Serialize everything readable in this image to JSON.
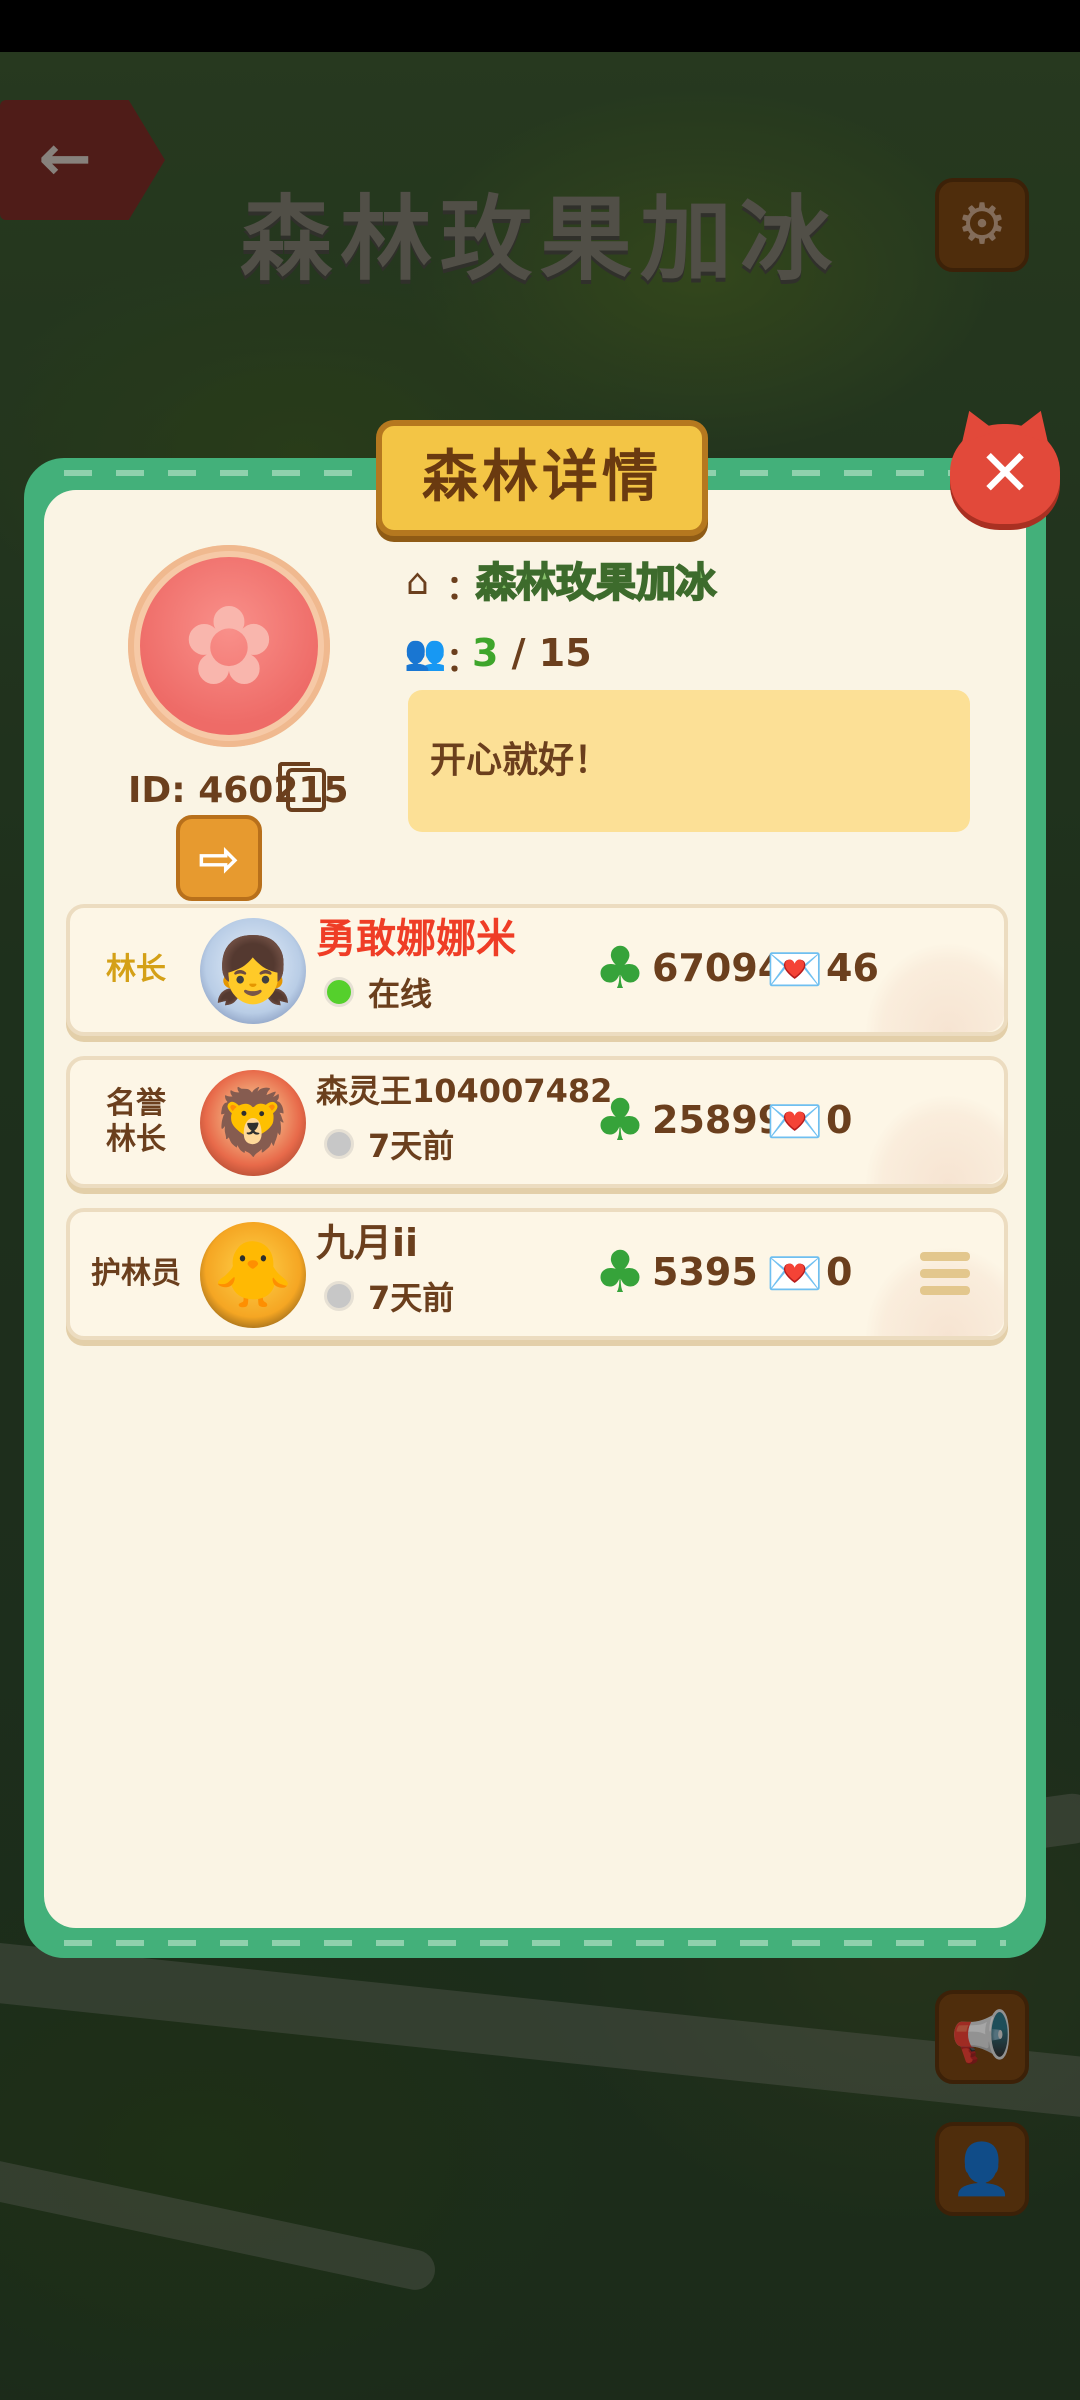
{
  "background": {
    "title": "森林玫果加冰",
    "back_icon": "arrow-left-icon",
    "settings_icon": "gear-icon",
    "side_buttons": [
      "megaphone-icon",
      "profile-card-icon"
    ]
  },
  "dialog": {
    "title": "森林详情",
    "close_label": "✕",
    "forest": {
      "id_text": "ID: 460215",
      "name_label": "：",
      "name": "森林玫果加冰",
      "members_label": "：",
      "members_current": "3",
      "members_sep": " / ",
      "members_max": "15",
      "motto": "开心就好！"
    },
    "members": [
      {
        "role": "林长",
        "name": "勇敢娜娜米",
        "status": "在线",
        "online": true,
        "clovers": "67094",
        "hearts": "46"
      },
      {
        "role": "名誉林长",
        "name": "森灵王104007482",
        "status": "7天前",
        "online": false,
        "clovers": "25899",
        "hearts": "0"
      },
      {
        "role": "护林员",
        "name": "九月ii",
        "status": "7天前",
        "online": false,
        "clovers": "5395",
        "hearts": "0"
      }
    ]
  },
  "colors": {
    "frame_green": "#43b07a",
    "panel_cream": "#faf4e4",
    "title_gold": "#f3c545",
    "close_red": "#e2493a",
    "leader_name_red": "#ef3d26",
    "clover_green": "#36a33a",
    "online_green": "#55d02c"
  }
}
